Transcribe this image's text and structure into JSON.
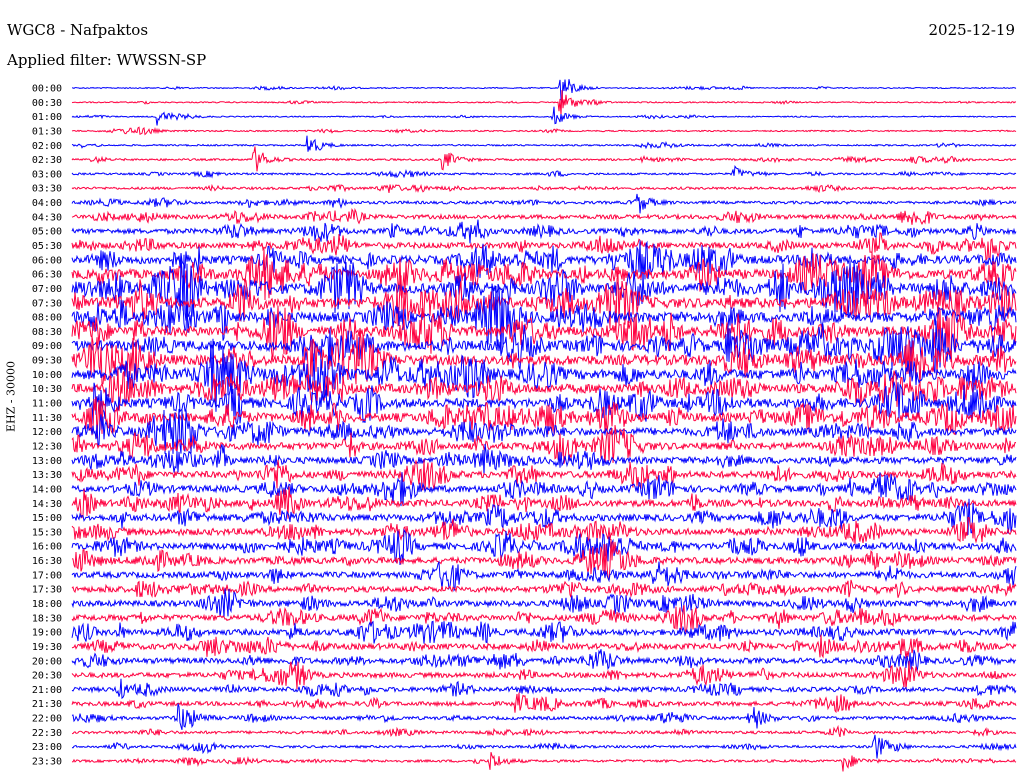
{
  "header": {
    "station": "WGC8 - Nafpaktos",
    "date": "2025-12-19",
    "filter": "Applied filter: WWSSN-SP"
  },
  "chart_data": {
    "type": "line",
    "subtype": "helicorder",
    "ylabel": "EHZ - 30000",
    "row_labels": [
      "00:00",
      "00:30",
      "01:00",
      "01:30",
      "02:00",
      "02:30",
      "03:00",
      "03:30",
      "04:00",
      "04:30",
      "05:00",
      "05:30",
      "06:00",
      "06:30",
      "07:00",
      "07:30",
      "08:00",
      "08:30",
      "09:00",
      "09:30",
      "10:00",
      "10:30",
      "11:00",
      "11:30",
      "12:00",
      "12:30",
      "13:00",
      "13:30",
      "14:00",
      "14:30",
      "15:00",
      "15:30",
      "16:00",
      "16:30",
      "17:00",
      "17:30",
      "18:00",
      "18:30",
      "19:00",
      "19:30",
      "20:00",
      "20:30",
      "21:00",
      "21:30",
      "22:00",
      "22:30",
      "23:00",
      "23:30"
    ],
    "row_minutes": 30,
    "relative_noise_amplitude": [
      0.05,
      0.06,
      0.05,
      0.08,
      0.1,
      0.15,
      0.15,
      0.2,
      0.25,
      0.4,
      0.5,
      0.6,
      0.9,
      1.0,
      1.1,
      1.1,
      1.1,
      1.1,
      1.1,
      1.1,
      1.1,
      1.0,
      1.0,
      0.95,
      0.8,
      0.75,
      0.7,
      0.7,
      0.7,
      0.7,
      0.7,
      0.7,
      0.7,
      0.65,
      0.6,
      0.6,
      0.6,
      0.6,
      0.6,
      0.6,
      0.55,
      0.5,
      0.45,
      0.4,
      0.3,
      0.25,
      0.2,
      0.2
    ],
    "events": [
      {
        "row": 0,
        "minute": 15.5,
        "amp": 3.0
      },
      {
        "row": 1,
        "minute": 15.5,
        "amp": 2.0
      },
      {
        "row": 2,
        "minute": 15.3,
        "amp": 1.5
      },
      {
        "row": 2,
        "minute": 2.7,
        "amp": 1.2
      },
      {
        "row": 4,
        "minute": 7.5,
        "amp": 1.8
      },
      {
        "row": 5,
        "minute": 5.8,
        "amp": 2.0
      },
      {
        "row": 5,
        "minute": 11.8,
        "amp": 1.5
      },
      {
        "row": 6,
        "minute": 21.0,
        "amp": 1.2
      },
      {
        "row": 8,
        "minute": 18.0,
        "amp": 1.4
      },
      {
        "row": 44,
        "minute": 3.4,
        "amp": 2.2
      },
      {
        "row": 44,
        "minute": 21.7,
        "amp": 1.5
      },
      {
        "row": 43,
        "minute": 14.1,
        "amp": 1.8
      },
      {
        "row": 46,
        "minute": 25.5,
        "amp": 2.2
      },
      {
        "row": 47,
        "minute": 13.3,
        "amp": 1.5
      },
      {
        "row": 47,
        "minute": 24.5,
        "amp": 1.6
      }
    ],
    "series_colors": {
      "even": "#0000ff",
      "odd": "#ff0040"
    }
  }
}
